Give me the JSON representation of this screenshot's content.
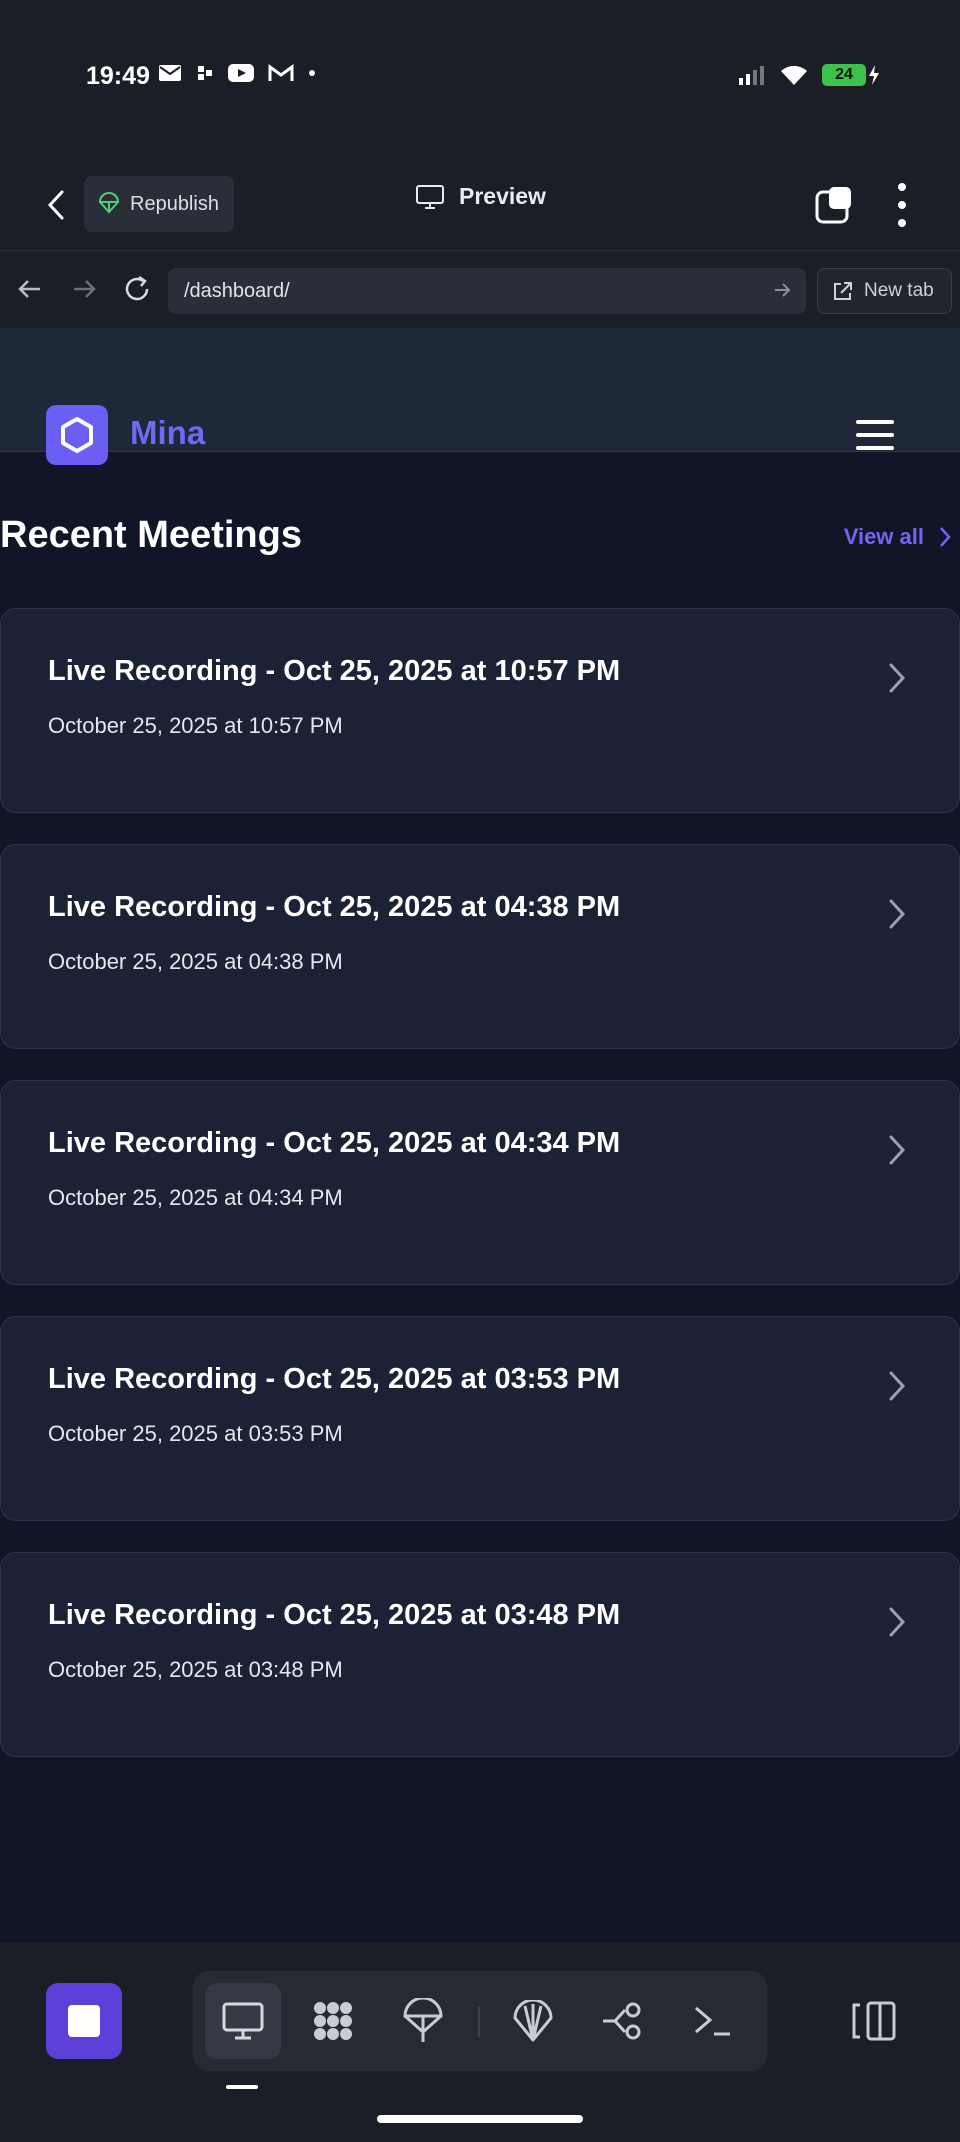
{
  "status": {
    "time": "19:49",
    "battery": "24"
  },
  "header": {
    "republish_label": "Republish",
    "preview_label": "Preview"
  },
  "urlbar": {
    "url": "/dashboard/",
    "new_tab_label": "New tab"
  },
  "site": {
    "brand": "Mina"
  },
  "meetings": {
    "title": "Recent Meetings",
    "view_all_label": "View all",
    "items": [
      {
        "title": "Live Recording - Oct 25, 2025 at 10:57 PM",
        "date": "October 25, 2025 at 10:57 PM"
      },
      {
        "title": "Live Recording - Oct 25, 2025 at 04:38 PM",
        "date": "October 25, 2025 at 04:38 PM"
      },
      {
        "title": "Live Recording - Oct 25, 2025 at 04:34 PM",
        "date": "October 25, 2025 at 04:34 PM"
      },
      {
        "title": "Live Recording - Oct 25, 2025 at 03:53 PM",
        "date": "October 25, 2025 at 03:53 PM"
      },
      {
        "title": "Live Recording - Oct 25, 2025 at 03:48 PM",
        "date": "October 25, 2025 at 03:48 PM"
      }
    ]
  },
  "toolbar": {
    "tools": [
      "monitor-icon",
      "grid-dots-icon",
      "parachute-icon",
      "shell-icon",
      "branch-icon",
      "terminal-icon"
    ]
  },
  "colors": {
    "accent": "#6f67f2",
    "stop_button": "#5b3fd6",
    "background": "#101628"
  }
}
